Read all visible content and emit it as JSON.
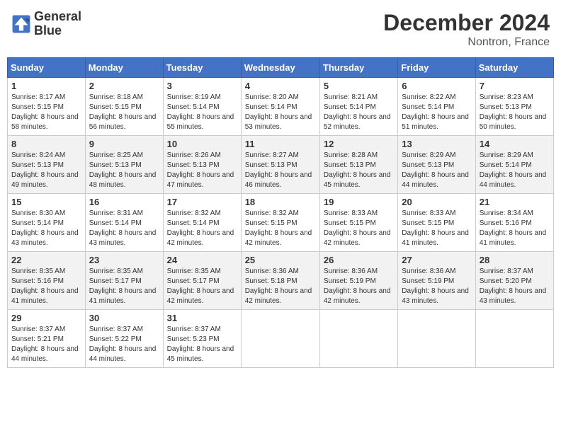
{
  "header": {
    "logo_line1": "General",
    "logo_line2": "Blue",
    "month_title": "December 2024",
    "location": "Nontron, France"
  },
  "weekdays": [
    "Sunday",
    "Monday",
    "Tuesday",
    "Wednesday",
    "Thursday",
    "Friday",
    "Saturday"
  ],
  "weeks": [
    [
      {
        "day": "1",
        "sunrise": "8:17 AM",
        "sunset": "5:15 PM",
        "daylight": "8 hours and 58 minutes"
      },
      {
        "day": "2",
        "sunrise": "8:18 AM",
        "sunset": "5:15 PM",
        "daylight": "8 hours and 56 minutes"
      },
      {
        "day": "3",
        "sunrise": "8:19 AM",
        "sunset": "5:14 PM",
        "daylight": "8 hours and 55 minutes"
      },
      {
        "day": "4",
        "sunrise": "8:20 AM",
        "sunset": "5:14 PM",
        "daylight": "8 hours and 53 minutes"
      },
      {
        "day": "5",
        "sunrise": "8:21 AM",
        "sunset": "5:14 PM",
        "daylight": "8 hours and 52 minutes"
      },
      {
        "day": "6",
        "sunrise": "8:22 AM",
        "sunset": "5:14 PM",
        "daylight": "8 hours and 51 minutes"
      },
      {
        "day": "7",
        "sunrise": "8:23 AM",
        "sunset": "5:13 PM",
        "daylight": "8 hours and 50 minutes"
      }
    ],
    [
      {
        "day": "8",
        "sunrise": "8:24 AM",
        "sunset": "5:13 PM",
        "daylight": "8 hours and 49 minutes"
      },
      {
        "day": "9",
        "sunrise": "8:25 AM",
        "sunset": "5:13 PM",
        "daylight": "8 hours and 48 minutes"
      },
      {
        "day": "10",
        "sunrise": "8:26 AM",
        "sunset": "5:13 PM",
        "daylight": "8 hours and 47 minutes"
      },
      {
        "day": "11",
        "sunrise": "8:27 AM",
        "sunset": "5:13 PM",
        "daylight": "8 hours and 46 minutes"
      },
      {
        "day": "12",
        "sunrise": "8:28 AM",
        "sunset": "5:13 PM",
        "daylight": "8 hours and 45 minutes"
      },
      {
        "day": "13",
        "sunrise": "8:29 AM",
        "sunset": "5:13 PM",
        "daylight": "8 hours and 44 minutes"
      },
      {
        "day": "14",
        "sunrise": "8:29 AM",
        "sunset": "5:14 PM",
        "daylight": "8 hours and 44 minutes"
      }
    ],
    [
      {
        "day": "15",
        "sunrise": "8:30 AM",
        "sunset": "5:14 PM",
        "daylight": "8 hours and 43 minutes"
      },
      {
        "day": "16",
        "sunrise": "8:31 AM",
        "sunset": "5:14 PM",
        "daylight": "8 hours and 43 minutes"
      },
      {
        "day": "17",
        "sunrise": "8:32 AM",
        "sunset": "5:14 PM",
        "daylight": "8 hours and 42 minutes"
      },
      {
        "day": "18",
        "sunrise": "8:32 AM",
        "sunset": "5:15 PM",
        "daylight": "8 hours and 42 minutes"
      },
      {
        "day": "19",
        "sunrise": "8:33 AM",
        "sunset": "5:15 PM",
        "daylight": "8 hours and 42 minutes"
      },
      {
        "day": "20",
        "sunrise": "8:33 AM",
        "sunset": "5:15 PM",
        "daylight": "8 hours and 41 minutes"
      },
      {
        "day": "21",
        "sunrise": "8:34 AM",
        "sunset": "5:16 PM",
        "daylight": "8 hours and 41 minutes"
      }
    ],
    [
      {
        "day": "22",
        "sunrise": "8:35 AM",
        "sunset": "5:16 PM",
        "daylight": "8 hours and 41 minutes"
      },
      {
        "day": "23",
        "sunrise": "8:35 AM",
        "sunset": "5:17 PM",
        "daylight": "8 hours and 41 minutes"
      },
      {
        "day": "24",
        "sunrise": "8:35 AM",
        "sunset": "5:17 PM",
        "daylight": "8 hours and 42 minutes"
      },
      {
        "day": "25",
        "sunrise": "8:36 AM",
        "sunset": "5:18 PM",
        "daylight": "8 hours and 42 minutes"
      },
      {
        "day": "26",
        "sunrise": "8:36 AM",
        "sunset": "5:19 PM",
        "daylight": "8 hours and 42 minutes"
      },
      {
        "day": "27",
        "sunrise": "8:36 AM",
        "sunset": "5:19 PM",
        "daylight": "8 hours and 43 minutes"
      },
      {
        "day": "28",
        "sunrise": "8:37 AM",
        "sunset": "5:20 PM",
        "daylight": "8 hours and 43 minutes"
      }
    ],
    [
      {
        "day": "29",
        "sunrise": "8:37 AM",
        "sunset": "5:21 PM",
        "daylight": "8 hours and 44 minutes"
      },
      {
        "day": "30",
        "sunrise": "8:37 AM",
        "sunset": "5:22 PM",
        "daylight": "8 hours and 44 minutes"
      },
      {
        "day": "31",
        "sunrise": "8:37 AM",
        "sunset": "5:23 PM",
        "daylight": "8 hours and 45 minutes"
      },
      null,
      null,
      null,
      null
    ]
  ],
  "labels": {
    "sunrise": "Sunrise:",
    "sunset": "Sunset:",
    "daylight": "Daylight:"
  }
}
